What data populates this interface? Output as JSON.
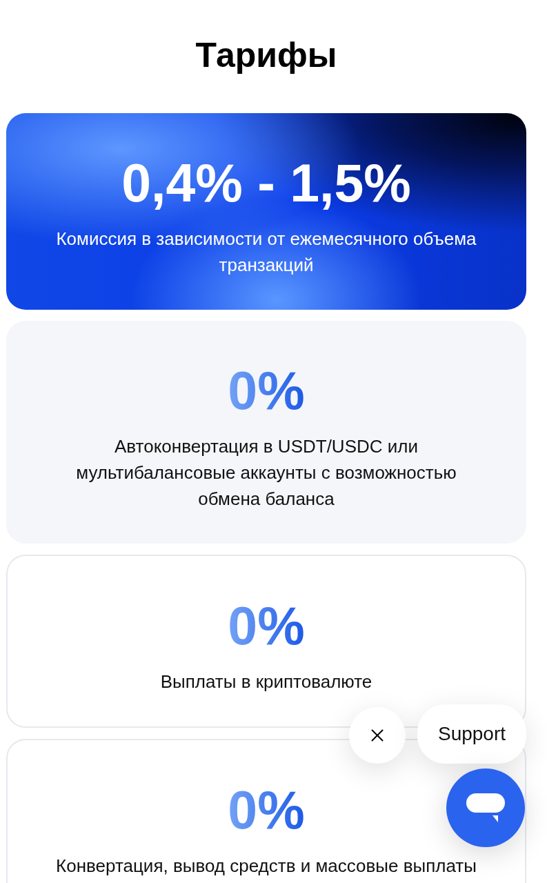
{
  "title": "Тарифы",
  "cards": [
    {
      "kind": "featured",
      "value": "0,4% - 1,5%",
      "description": "Комиссия в зависимости от ежемесячного объема транзакций"
    },
    {
      "kind": "filled",
      "value": "0%",
      "description": "Автоконвертация в USDT/USDC или мультибалансовые аккаунты с возможностью обмена баланса"
    },
    {
      "kind": "outlined",
      "value": "0%",
      "description": "Выплаты в криптовалюте"
    },
    {
      "kind": "outlined",
      "value": "0%",
      "description": "Конвертация, вывод средств и массовые выплаты"
    }
  ],
  "support_widget": {
    "label": "Support"
  }
}
